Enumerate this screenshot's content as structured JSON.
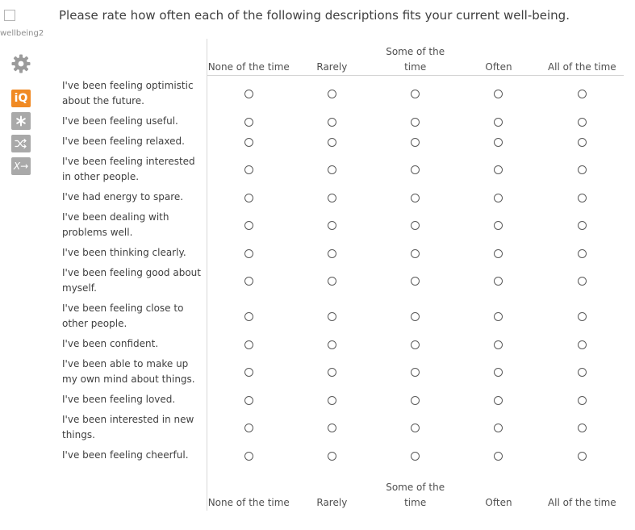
{
  "sidebar": {
    "question_id": "wellbeing2",
    "icons": [
      "gear-icon",
      "iq-icon",
      "asterisk-icon",
      "randomize-icon",
      "variable-icon"
    ],
    "iq_label": "iQ",
    "x_label": "X→",
    "accent_color": "#f08a24",
    "tool_color": "#a9a9a9"
  },
  "question": {
    "text": "Please rate how often each of the following descriptions fits your current well-being."
  },
  "columns": [
    "None of the time",
    "Rarely",
    "Some of the time",
    "Often",
    "All of the time"
  ],
  "statements": [
    "I've been feeling optimistic about the future.",
    "I've been feeling useful.",
    "I've been feeling relaxed.",
    "I've been feeling interested in other people.",
    "I've had energy to spare.",
    "I've been dealing with problems well.",
    "I've been thinking clearly.",
    "I've been feeling good about myself.",
    "I've been feeling close to other people.",
    "I've been confident.",
    "I've been able to make up my own mind about things.",
    "I've been feeling loved.",
    "I've been interested in new things.",
    "I've been feeling cheerful."
  ]
}
